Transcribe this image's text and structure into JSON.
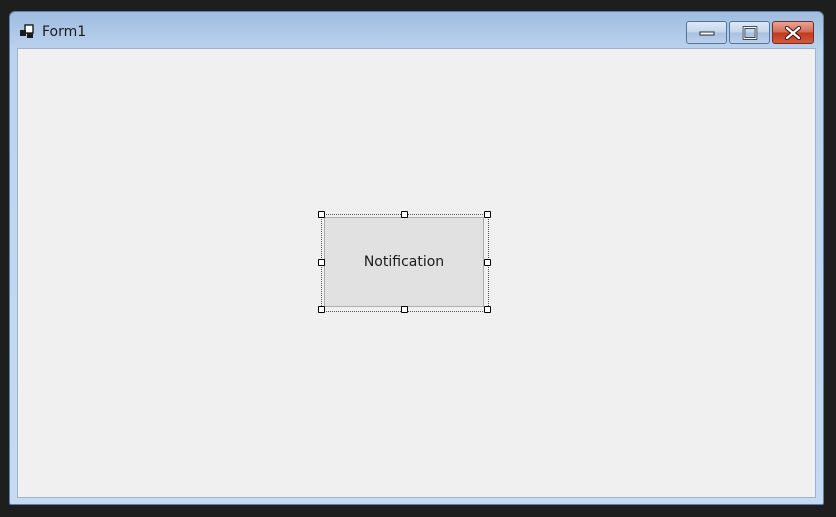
{
  "window": {
    "title": "Form1"
  },
  "caption_buttons": {
    "minimize_icon": "minimize-icon",
    "maximize_icon": "maximize-icon",
    "close_icon": "close-icon"
  },
  "form": {
    "button_label": "Notification"
  },
  "colors": {
    "client_background": "#f0f0f0",
    "button_face": "#e1e1e1",
    "close_button": "#c0391f",
    "frame": "#bcd3ee"
  }
}
